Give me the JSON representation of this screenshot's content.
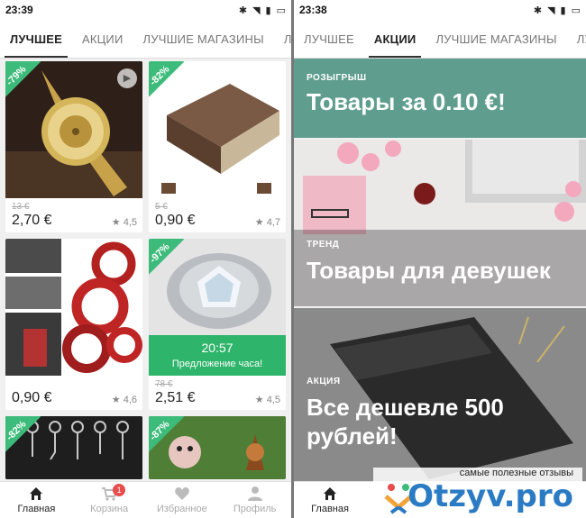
{
  "left": {
    "time": "23:39",
    "tabs": [
      "ЛУЧШЕЕ",
      "АКЦИИ",
      "ЛУЧШИЕ МАГАЗИНЫ",
      "ЛУЧ"
    ],
    "cards": [
      {
        "discount": "-79%",
        "old_price": "13 €",
        "price": "2,70 €",
        "rating": "★ 4,5"
      },
      {
        "discount": "-82%",
        "old_price": "5 €",
        "price": "0,90 €",
        "rating": "★ 4,7"
      },
      {
        "discount": "",
        "old_price": "",
        "price": "0,90 €",
        "rating": "★ 4,6"
      },
      {
        "discount": "-97%",
        "old_price": "78 €",
        "price": "2,51 €",
        "rating": "★ 4,5",
        "timer": "20:57",
        "offer_label": "Предложение часа!"
      },
      {
        "discount": "-82%"
      },
      {
        "discount": "-87%"
      }
    ],
    "nav": [
      {
        "label": "Главная"
      },
      {
        "label": "Корзина",
        "badge": "1"
      },
      {
        "label": "Избранное"
      },
      {
        "label": "Профиль"
      }
    ]
  },
  "right": {
    "time": "23:38",
    "tabs": [
      "ЛУЧШЕЕ",
      "АКЦИИ",
      "ЛУЧШИЕ МАГАЗИНЫ",
      "ЛУЧ"
    ],
    "promos": [
      {
        "tag": "РОЗЫГРЫШ",
        "title": "Товары за 0.10 €!"
      },
      {
        "tag": "ТРЕНД",
        "title": "Товары для девушек"
      },
      {
        "tag": "АКЦИЯ",
        "title": "Все дешевле 500 рублей!"
      }
    ],
    "nav": [
      {
        "label": "Главная"
      }
    ]
  },
  "watermark": {
    "caption": "самые полезные отзывы",
    "brand": "Otzyv.pro"
  },
  "colors": {
    "accent": "#3dbb7a",
    "badge": "#e94c4c",
    "teal_banner": "#5f9e8e"
  }
}
